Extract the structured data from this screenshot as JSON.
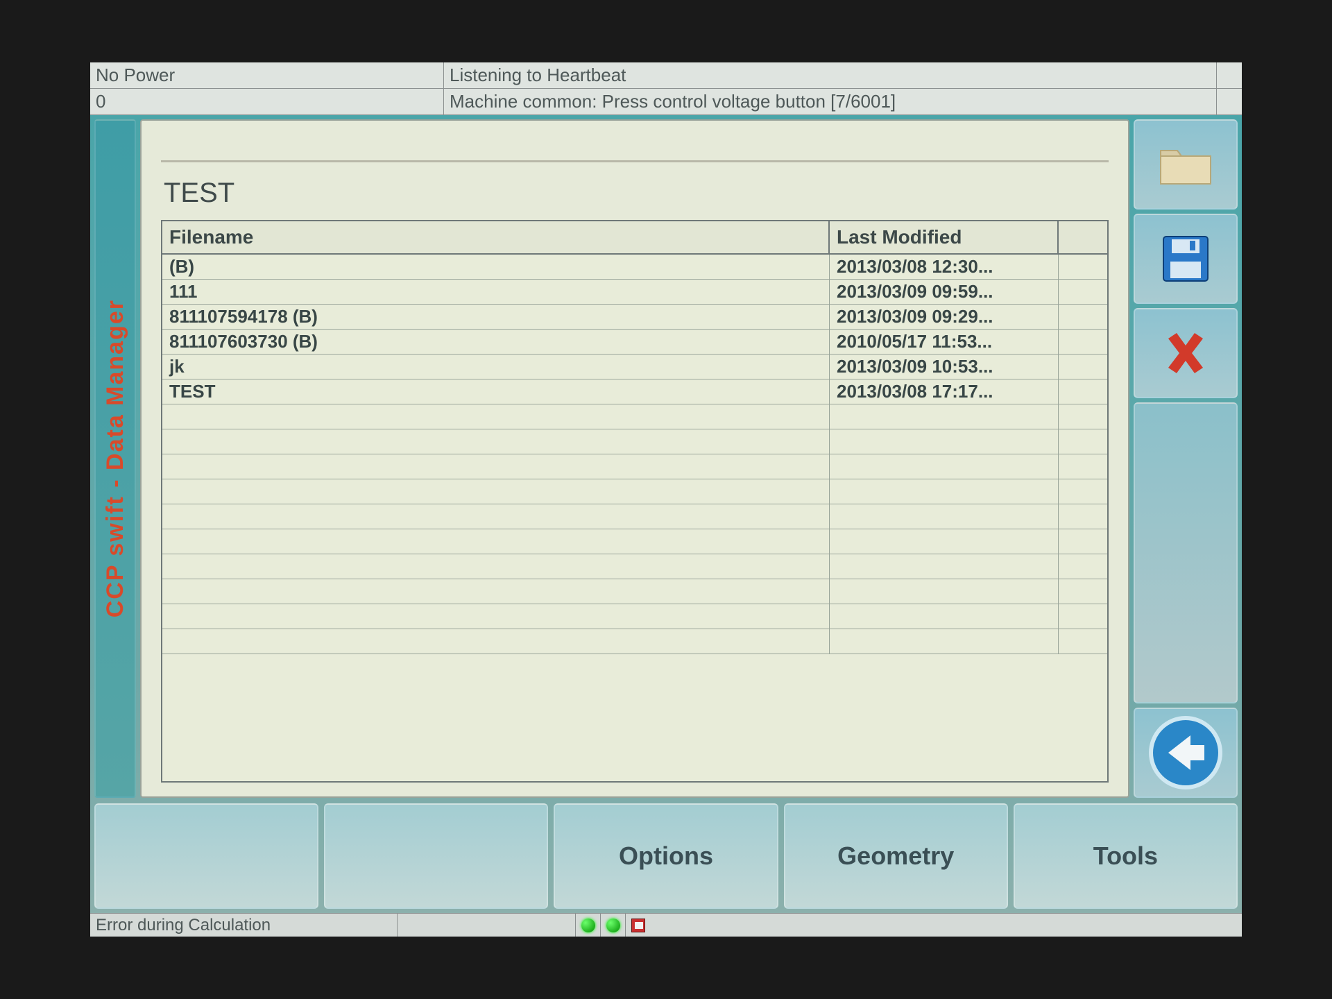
{
  "status": {
    "row1_left": "No Power",
    "row1_right": "Listening to Heartbeat",
    "row2_left": "0",
    "row2_right": "Machine common: Press control voltage button   [7/6001]"
  },
  "sidebar_title": "CCP swift - Data Manager",
  "directory_title": "TEST",
  "columns": {
    "filename": "Filename",
    "last_modified": "Last Modified"
  },
  "rows": [
    {
      "filename": " (B)",
      "last_modified": "2013/03/08 12:30..."
    },
    {
      "filename": "111",
      "last_modified": "2013/03/09 09:59..."
    },
    {
      "filename": "811107594178 (B)",
      "last_modified": "2013/03/09 09:29..."
    },
    {
      "filename": "811107603730 (B)",
      "last_modified": "2010/05/17 11:53..."
    },
    {
      "filename": "jk",
      "last_modified": "2013/03/09 10:53..."
    },
    {
      "filename": "TEST",
      "last_modified": "2013/03/08 17:17..."
    }
  ],
  "bottom_buttons": {
    "b1": "",
    "b2": "",
    "b3": "Options",
    "b4": "Geometry",
    "b5": "Tools"
  },
  "right_icons": {
    "folder": "folder-icon",
    "save": "floppy-icon",
    "delete": "x-icon",
    "back": "back-arrow-icon"
  },
  "footer": {
    "text": "Error during Calculation"
  }
}
